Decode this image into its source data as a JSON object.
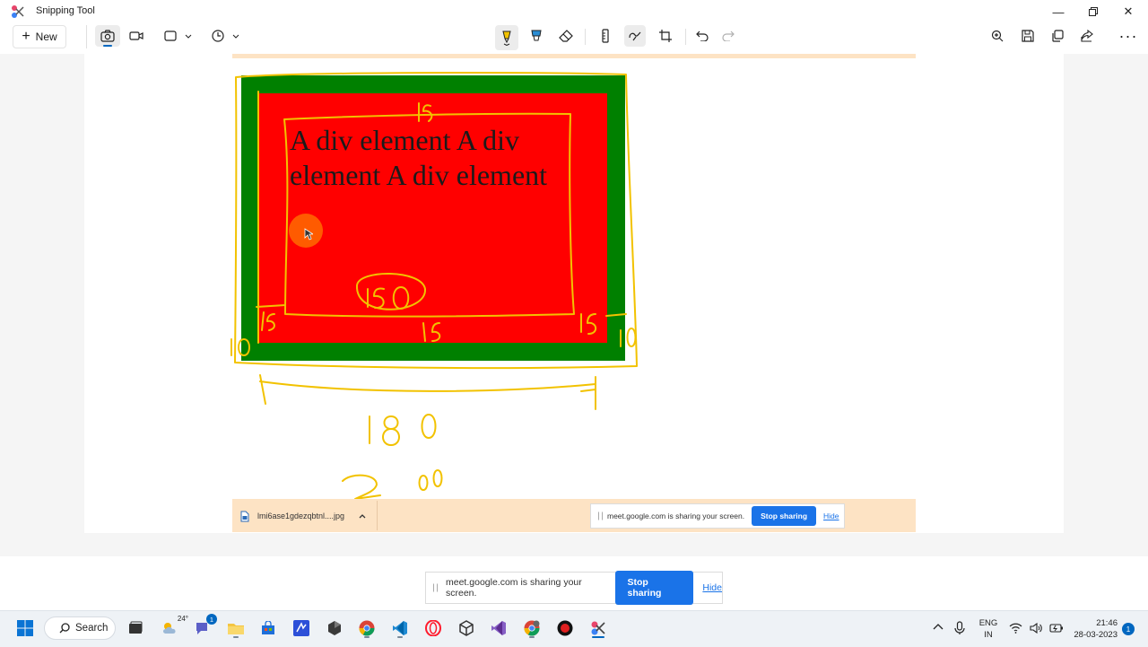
{
  "window": {
    "title": "Snipping Tool",
    "controls": [
      "minimize-icon",
      "restore-icon",
      "close-icon"
    ]
  },
  "toolbar": {
    "new_label": "New",
    "left_icons": [
      "camera-icon",
      "video-icon",
      "rectangle-mode-icon",
      "timer-icon"
    ],
    "center_icons": [
      "ballpoint-pen-icon",
      "highlighter-icon",
      "eraser-icon",
      "ruler-icon",
      "touch-writing-icon",
      "crop-icon",
      "undo-icon",
      "redo-icon"
    ],
    "right_icons": [
      "zoom-icon",
      "save-icon",
      "copy-icon",
      "share-icon",
      "more-icon"
    ]
  },
  "canvas": {
    "div_text": "A div element A div element A div element",
    "colors": {
      "outer": "#008000",
      "inner": "#ff0000",
      "ink": "#f2c200"
    },
    "annotations": [
      "15",
      "15",
      "15",
      "15",
      "10",
      "10",
      "150",
      "180",
      "200"
    ]
  },
  "download_bar": {
    "filename": "lmi6ase1gdezqbtnl....jpg"
  },
  "share_notice_inner": {
    "message": "meet.google.com is sharing your screen.",
    "stop_label": "Stop sharing",
    "hide_label": "Hide"
  },
  "share_notice": {
    "message": "meet.google.com is sharing your screen.",
    "stop_label": "Stop sharing",
    "hide_label": "Hide"
  },
  "taskbar": {
    "search_label": "Search",
    "weather_temp": "24°",
    "chat_badge": "1",
    "apps": [
      "start-icon",
      "task-view-icon",
      "weather-icon",
      "chat-icon",
      "file-explorer-icon",
      "store-icon",
      "visual-studio-icon",
      "app-icon",
      "chrome-icon",
      "vscode-icon",
      "opera-icon",
      "unity-icon",
      "visual-studio-purple-icon",
      "chrome-profile-icon",
      "record-icon",
      "snipping-tool-icon"
    ],
    "tray": {
      "lang_top": "ENG",
      "lang_bottom": "IN",
      "time": "21:46",
      "date": "28-03-2023",
      "notification_count": "1"
    }
  }
}
